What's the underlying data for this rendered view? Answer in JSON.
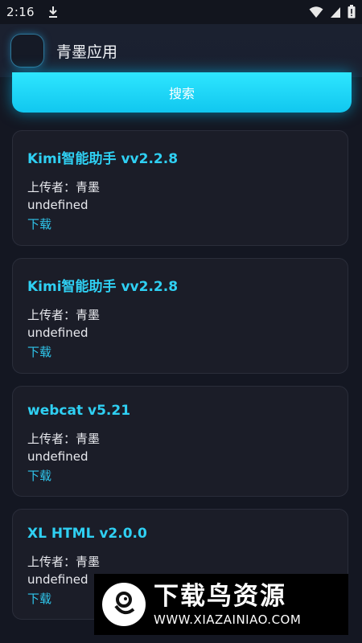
{
  "status_bar": {
    "time": "2:16"
  },
  "app_bar": {
    "title": "青墨应用"
  },
  "search": {
    "label": "搜索"
  },
  "apps": [
    {
      "title": "Kimi智能助手 vv2.2.8",
      "uploader": "上传者：青墨",
      "description": "undefined",
      "download_label": "下载"
    },
    {
      "title": "Kimi智能助手 vv2.2.8",
      "uploader": "上传者：青墨",
      "description": "undefined",
      "download_label": "下载"
    },
    {
      "title": "webcat v5.21",
      "uploader": "上传者：青墨",
      "description": "undefined",
      "download_label": "下载"
    },
    {
      "title": "XL HTML v2.0.0",
      "uploader": "上传者：青墨",
      "description": "undefined",
      "download_label": "下载"
    }
  ],
  "watermark": {
    "site_name": "下载鸟资源",
    "url": "WWW.XIAZAINIAO.COM"
  },
  "colors": {
    "accent": "#2fd0f3",
    "background": "#141722",
    "card": "#1b1d28"
  }
}
